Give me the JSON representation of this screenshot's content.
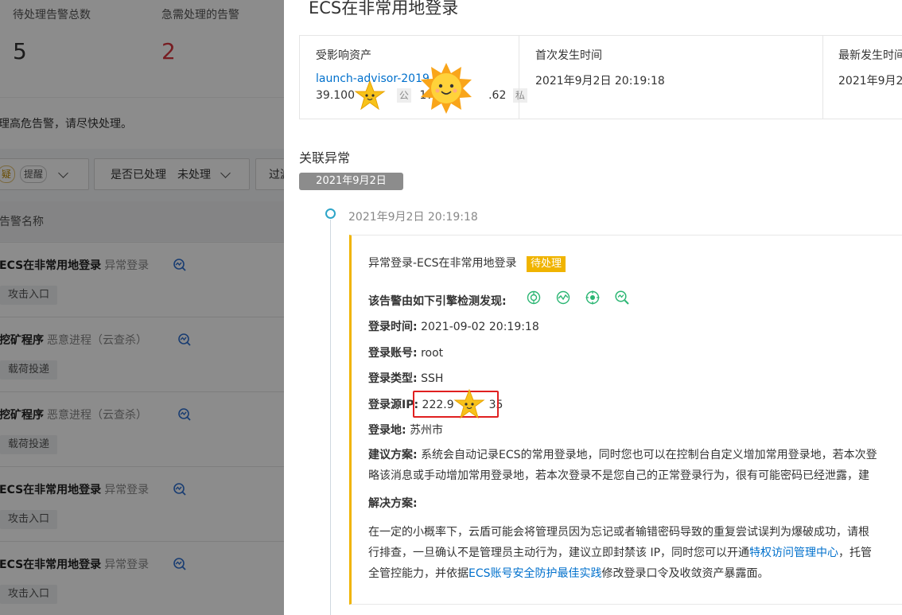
{
  "left": {
    "stats": [
      {
        "label": "待处理告警总数",
        "value": "5",
        "color": "#333333"
      },
      {
        "label": "急需处理的告警",
        "value": "2",
        "color": "#d9363e"
      }
    ],
    "notice": "理高危告警，请尽快处理。",
    "filters": {
      "level_tags": [
        "疑",
        "提醒"
      ],
      "handled_label": "是否已处理",
      "handled_value": "未处理",
      "third_label": "过滤"
    },
    "table_header": "告警名称",
    "rows": [
      {
        "name": "ECS在非常用地登录",
        "type": "异常登录",
        "tag": "攻击入口"
      },
      {
        "name": "挖矿程序",
        "type": "恶意进程（云查杀）",
        "tag": "载荷投递"
      },
      {
        "name": "挖矿程序",
        "type": "恶意进程（云查杀）",
        "tag": "载荷投递"
      },
      {
        "name": "ECS在非常用地登录",
        "type": "异常登录",
        "tag": "攻击入口"
      },
      {
        "name": "ECS在非常用地登录",
        "type": "异常登录",
        "tag": "攻击入口"
      }
    ]
  },
  "drawer": {
    "title": "ECS在非常用地登录",
    "summary": {
      "asset_header": "受影响资产",
      "asset_link": "launch-advisor-2019",
      "public_ip": "39.100",
      "public_chip": "公",
      "private_ip_prefix": "17",
      "private_ip_suffix": ".62",
      "private_chip": "私",
      "first_header": "首次发生时间",
      "first_value": "2021年9月2日 20:19:18",
      "latest_header": "最新发生时间",
      "latest_value": "2021年9月2"
    },
    "related_title": "关联异常",
    "date_pill": "2021年9月2日",
    "event": {
      "time": "2021年9月2日 20:19:18",
      "title": "异常登录-ECS在非常用地登录",
      "status": "待处理",
      "engines_label": "该告警由如下引擎检测发现:",
      "engine_icons": [
        "engine-a-icon",
        "engine-b-icon",
        "engine-c-icon",
        "engine-d-icon"
      ],
      "fields": [
        {
          "label": "登录时间:",
          "value": "2021-09-02 20:19:18"
        },
        {
          "label": "登录账号:",
          "value": "root"
        },
        {
          "label": "登录类型:",
          "value": "SSH"
        },
        {
          "label": "登录源IP:",
          "value": "222.9",
          "value_tail": "35"
        },
        {
          "label": "登录地:",
          "value": "苏州市"
        }
      ],
      "advice_label": "建议方案:",
      "advice_line1": "系统会自动记录ECS的常用登录地，同时您也可以在控制台自定义增加常用登录地，若本次登",
      "advice_line2": "略该消息或手动增加常用登录地，若本次登录不是您自己的正常登录行为，很有可能密码已经泄露，建",
      "solution_label": "解决方案:",
      "solution_line1": "在一定的小概率下，云盾可能会将管理员因为忘记或者输错密码导致的重复尝试误判为爆破成功，请根",
      "solution_line2_a": "行排查，一旦确认不是管理员主动行为，建议立即封禁该 IP，同时您可以开通",
      "solution_link1": "特权访问管理中心",
      "solution_line2_b": "，托管",
      "solution_line3_a": "全管控能力，并依据",
      "solution_link2": "ECS账号安全防护最佳实践",
      "solution_line3_b": "修改登录口令及收敛资产暴露面。"
    }
  },
  "colors": {
    "accent_link": "#0070cc",
    "status": "#f0b400",
    "highlight": "#e02020",
    "timeline_dot": "#2ea5c8"
  }
}
